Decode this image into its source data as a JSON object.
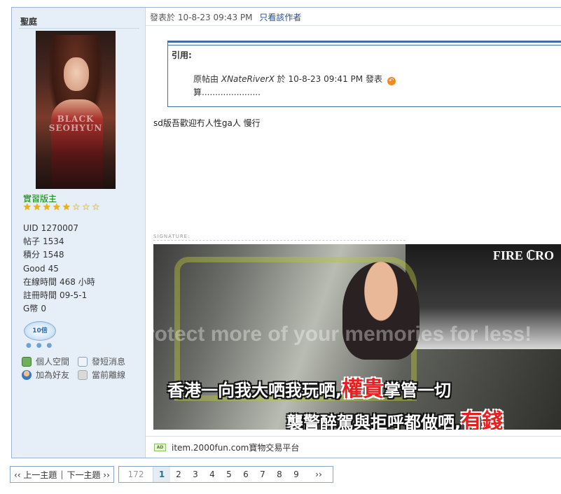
{
  "sidebar": {
    "author_name": "聖庭",
    "avatar_watermark": "BLACK SEOHYUN",
    "rank": "實習版主",
    "stars": {
      "filled": 5,
      "half": 0,
      "empty": 3,
      "total": 8
    },
    "info": [
      {
        "label": "UID",
        "value": "1270007"
      },
      {
        "label": "帖子",
        "value": "1534"
      },
      {
        "label": "積分",
        "value": "1548"
      },
      {
        "label": "Good",
        "value": "45"
      },
      {
        "label": "在線時間",
        "value": "468 小時"
      },
      {
        "label": "註冊時間",
        "value": "09-5-1"
      },
      {
        "label": "G幣",
        "value": "0"
      }
    ],
    "online_badge": "10倍",
    "actions": {
      "home": "個人空間",
      "message": "發短消息",
      "add_friend": "加為好友",
      "offline": "當前離線"
    }
  },
  "post": {
    "posted_prefix": "發表於",
    "posted_time": "10-8-23 09:43 PM",
    "author_only": "只看該作者",
    "quote": {
      "title": "引用:",
      "prefix": "原帖由",
      "author": "XNateRiverX",
      "at": "於",
      "time": "10-8-23 09:41 PM",
      "suffix": "發表",
      "content": "算......................"
    },
    "message": "sd版吾歡迎冇人性ga人 慢行",
    "signature_label": "SIGNATURE:",
    "signature_image": {
      "sign": "FIRE ℂRO",
      "watermark": "Protect more of your memories for less!",
      "caption1_pre": "香港一向我大哂我玩哂,",
      "caption1_red": "權貴",
      "caption1_post": "掌管一切",
      "caption2_pre": "襲警醉駕與拒呼都做哂,",
      "caption2_red": "有錢"
    },
    "ad_badge": "AD",
    "ad_text": "item.2000fun.com寶物交易平台"
  },
  "navigation": {
    "prev_thread": "‹‹ 上一主題",
    "divider": "|",
    "next_thread": "下一主題 ››",
    "total_pages": "172",
    "pages": [
      "1",
      "2",
      "3",
      "4",
      "5",
      "6",
      "7",
      "8",
      "9"
    ],
    "current_page": "1",
    "next_label": "››"
  },
  "colors": {
    "sidebar_bg": "#e6eef8",
    "border": "#9fb5cf",
    "quote_accent": "#3e6ea8",
    "rank_green": "#008000",
    "link_blue": "#224f8f"
  }
}
